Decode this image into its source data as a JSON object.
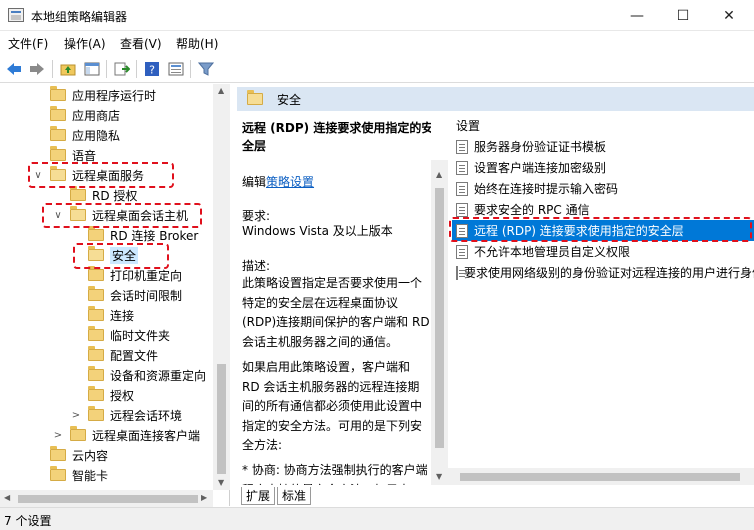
{
  "window": {
    "title": "本地组策略编辑器",
    "minimize_glyph": "—",
    "maximize_glyph": "☐",
    "close_glyph": "✕"
  },
  "menu": [
    "文件(F)",
    "操作(A)",
    "查看(V)",
    "帮助(H)"
  ],
  "toolbar_icons": [
    "back-icon",
    "forward-icon",
    "up-folder-icon",
    "show-hide-tree-icon",
    "export-list-icon",
    "help-icon",
    "properties-icon",
    "filter-icon"
  ],
  "tree": [
    {
      "label": "应用程序运行时",
      "expander": ""
    },
    {
      "label": "应用商店",
      "expander": ""
    },
    {
      "label": "应用隐私",
      "expander": ""
    },
    {
      "label": "语音",
      "expander": ""
    },
    {
      "label": "远程桌面服务",
      "expander": "∨"
    },
    {
      "label": "RD 授权",
      "expander": ""
    },
    {
      "label": "远程桌面会话主机",
      "expander": "∨"
    },
    {
      "label": "RD 连接 Broker",
      "expander": ""
    },
    {
      "label": "安全",
      "expander": ""
    },
    {
      "label": "打印机重定向",
      "expander": ""
    },
    {
      "label": "会话时间限制",
      "expander": ""
    },
    {
      "label": "连接",
      "expander": ""
    },
    {
      "label": "临时文件夹",
      "expander": ""
    },
    {
      "label": "配置文件",
      "expander": ""
    },
    {
      "label": "设备和资源重定向",
      "expander": ""
    },
    {
      "label": "授权",
      "expander": ""
    },
    {
      "label": "远程会话环境",
      "expander": ">"
    },
    {
      "label": "远程桌面连接客户端",
      "expander": ">"
    },
    {
      "label": "云内容",
      "expander": ""
    },
    {
      "label": "智能卡",
      "expander": ""
    }
  ],
  "detail": {
    "header": "安全",
    "title": "远程 (RDP) 连接要求使用指定的安全层",
    "edit_prefix": "编辑",
    "edit_link": "策略设置",
    "req_label": "要求:",
    "req_value": "Windows Vista 及以上版本",
    "desc_label": "描述:",
    "desc_text": "此策略设置指定是否要求使用一个特定的安全层在远程桌面协议(RDP)连接期间保护的客户端和 RD 会话主机服务器之间的通信。",
    "desc_text2": "如果启用此策略设置，客户端和 RD 会话主机服务器的远程连接期间的所有通信都必须使用此设置中指定的安全方法。可用的是下列安全方法:",
    "desc_text3": "* 协商: 协商方法强制执行的客户端程序支持的最安全方法。如果支"
  },
  "settings": {
    "header": "设置",
    "items": [
      "服务器身份验证证书模板",
      "设置客户端连接加密级别",
      "始终在连接时提示输入密码",
      "要求安全的 RPC 通信",
      "远程 (RDP) 连接要求使用指定的安全层",
      "不允许本地管理员自定义权限",
      "要求使用网络级别的身份验证对远程连接的用户进行身份验证"
    ],
    "selected_index": 4
  },
  "tabs": [
    "扩展",
    "标准"
  ],
  "status": "7 个设置",
  "colors": {
    "selection": "#0078d7",
    "header_bg": "#dae6f3",
    "highlight": "#e0101c"
  }
}
